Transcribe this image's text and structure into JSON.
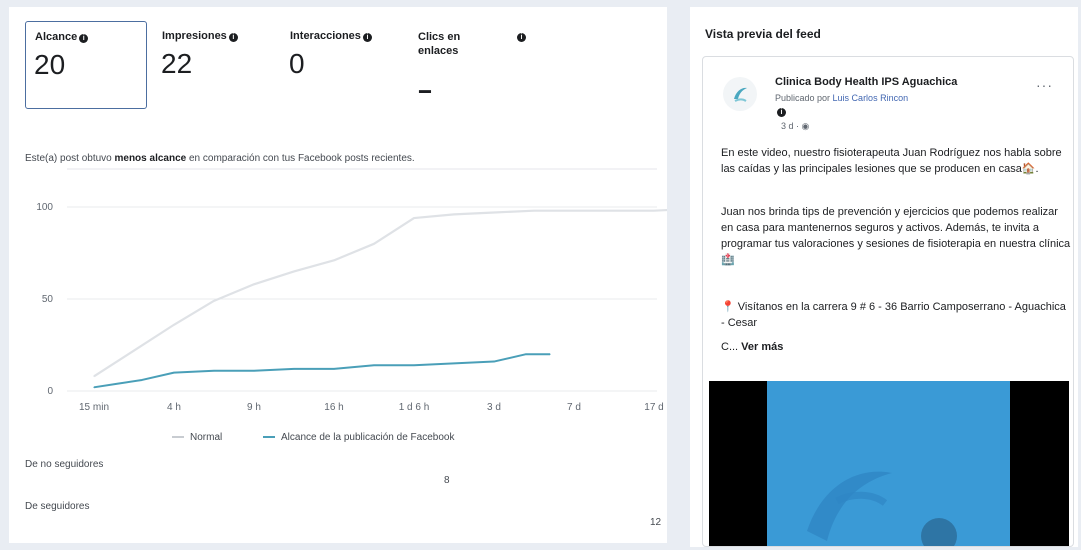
{
  "metrics": {
    "alcance": {
      "label": "Alcance",
      "value": "20"
    },
    "impresiones": {
      "label": "Impresiones",
      "value": "22"
    },
    "interacciones": {
      "label": "Interacciones",
      "value": "0"
    },
    "clics": {
      "label_line1": "Clics en",
      "label_line2": "enlaces",
      "value": "--"
    }
  },
  "comparison": {
    "prefix": "Este(a) post obtuvo ",
    "bold": "menos alcance",
    "suffix": " en comparación con tus Facebook posts recientes."
  },
  "chart_data": {
    "type": "line",
    "x": [
      "15 min",
      "4 h",
      "9 h",
      "16 h",
      "1 d 6 h",
      "3 d",
      "7 d",
      "17 d"
    ],
    "y_ticks": [
      "0",
      "50",
      "100"
    ],
    "ylim": [
      0,
      100
    ],
    "series": [
      {
        "name": "Normal",
        "color": "#dfe2e6",
        "values": [
          [
            0,
            8
          ],
          [
            0.5,
            22
          ],
          [
            1,
            36
          ],
          [
            1.5,
            49
          ],
          [
            2,
            58
          ],
          [
            2.5,
            65
          ],
          [
            3,
            71
          ],
          [
            3.5,
            80
          ],
          [
            4,
            94
          ],
          [
            4.5,
            96
          ],
          [
            5,
            97
          ],
          [
            5.5,
            98
          ],
          [
            6,
            98
          ],
          [
            6.5,
            98
          ],
          [
            7,
            98
          ],
          [
            7.5,
            99
          ]
        ]
      },
      {
        "name": "Alcance de la publicación de Facebook",
        "color": "#4a9fb8",
        "values": [
          [
            0,
            2
          ],
          [
            0.3,
            4
          ],
          [
            0.6,
            6
          ],
          [
            1,
            10
          ],
          [
            1.5,
            11
          ],
          [
            2,
            11
          ],
          [
            2.5,
            12
          ],
          [
            3,
            12
          ],
          [
            3.5,
            14
          ],
          [
            4,
            14
          ],
          [
            4.5,
            15
          ],
          [
            5,
            16
          ],
          [
            5.4,
            20
          ],
          [
            5.7,
            20
          ]
        ]
      }
    ],
    "legend_position": "bottom"
  },
  "audience": {
    "no_followers": {
      "label": "De no seguidores",
      "value": "8"
    },
    "followers": {
      "label": "De seguidores",
      "value": "12"
    }
  },
  "preview": {
    "title": "Vista previa del feed",
    "page_name": "Clinica Body Health IPS Aguachica",
    "published_prefix": "Publicado por ",
    "author": "Luis Carlos Rincon",
    "time": "3 d · ",
    "paragraph1": "En este video, nuestro fisioterapeuta Juan Rodríguez nos habla sobre las caídas y las principales lesiones que se producen en casa🏠.",
    "paragraph2": "Juan nos brinda tips de prevención y ejercicios que podemos realizar en casa para mantenernos seguros y activos. Además, te invita a programar tus valoraciones y sesiones de fisioterapia en nuestra clínica🏥",
    "paragraph3": "📍 Visítanos en la carrera 9 # 6 - 36 Barrio Camposerrano - Aguachica - Cesar",
    "truncated": "C... ",
    "see_more": "Ver más"
  }
}
